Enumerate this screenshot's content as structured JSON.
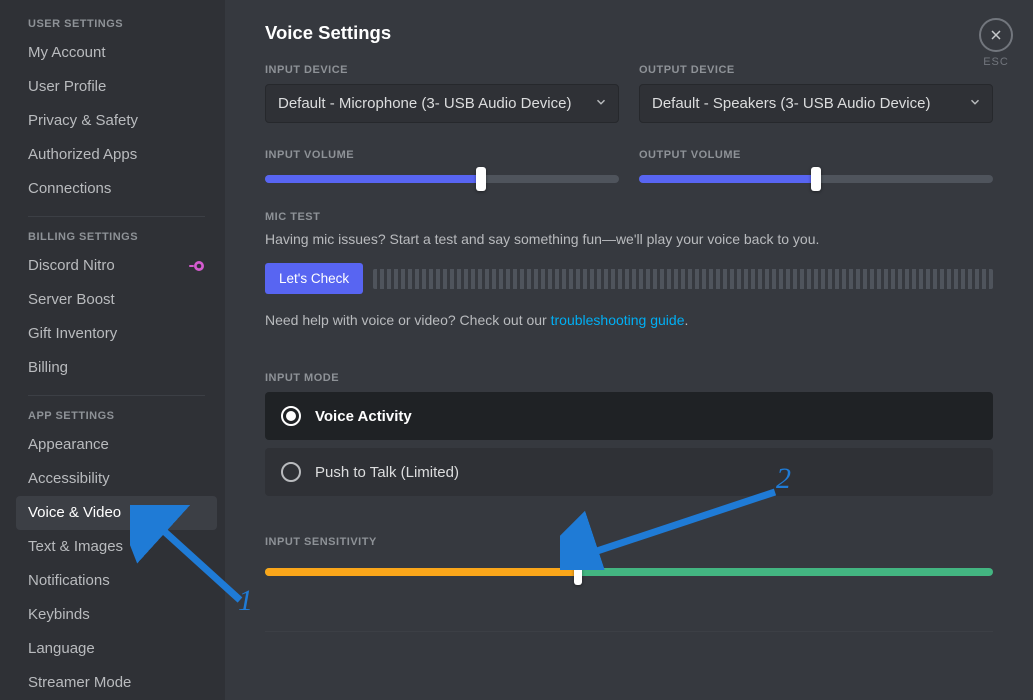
{
  "close_label": "ESC",
  "page_title": "Voice Settings",
  "sidebar": {
    "sections": [
      {
        "header": "USER SETTINGS",
        "items": [
          {
            "label": "My Account"
          },
          {
            "label": "User Profile"
          },
          {
            "label": "Privacy & Safety"
          },
          {
            "label": "Authorized Apps"
          },
          {
            "label": "Connections"
          }
        ]
      },
      {
        "header": "BILLING SETTINGS",
        "items": [
          {
            "label": "Discord Nitro",
            "badge": "nitro"
          },
          {
            "label": "Server Boost"
          },
          {
            "label": "Gift Inventory"
          },
          {
            "label": "Billing"
          }
        ]
      },
      {
        "header": "APP SETTINGS",
        "items": [
          {
            "label": "Appearance"
          },
          {
            "label": "Accessibility"
          },
          {
            "label": "Voice & Video",
            "active": true
          },
          {
            "label": "Text & Images"
          },
          {
            "label": "Notifications"
          },
          {
            "label": "Keybinds"
          },
          {
            "label": "Language"
          },
          {
            "label": "Streamer Mode"
          }
        ]
      }
    ]
  },
  "devices": {
    "input_label": "INPUT DEVICE",
    "input_value": "Default - Microphone (3- USB Audio Device)",
    "output_label": "OUTPUT DEVICE",
    "output_value": "Default - Speakers (3- USB Audio Device)"
  },
  "volumes": {
    "input_label": "INPUT VOLUME",
    "input_percent": 61,
    "output_label": "OUTPUT VOLUME",
    "output_percent": 50
  },
  "mic_test": {
    "header": "MIC TEST",
    "desc": "Having mic issues? Start a test and say something fun—we'll play your voice back to you.",
    "button": "Let's Check"
  },
  "help": {
    "prefix": "Need help with voice or video? Check out our ",
    "link_text": "troubleshooting guide",
    "suffix": "."
  },
  "input_mode": {
    "header": "INPUT MODE",
    "option_voice": "Voice Activity",
    "option_ptt": "Push to Talk (Limited)",
    "selected": "voice"
  },
  "sensitivity": {
    "header": "INPUT SENSITIVITY",
    "percent": 43
  },
  "annotations": {
    "one": "1",
    "two": "2"
  }
}
